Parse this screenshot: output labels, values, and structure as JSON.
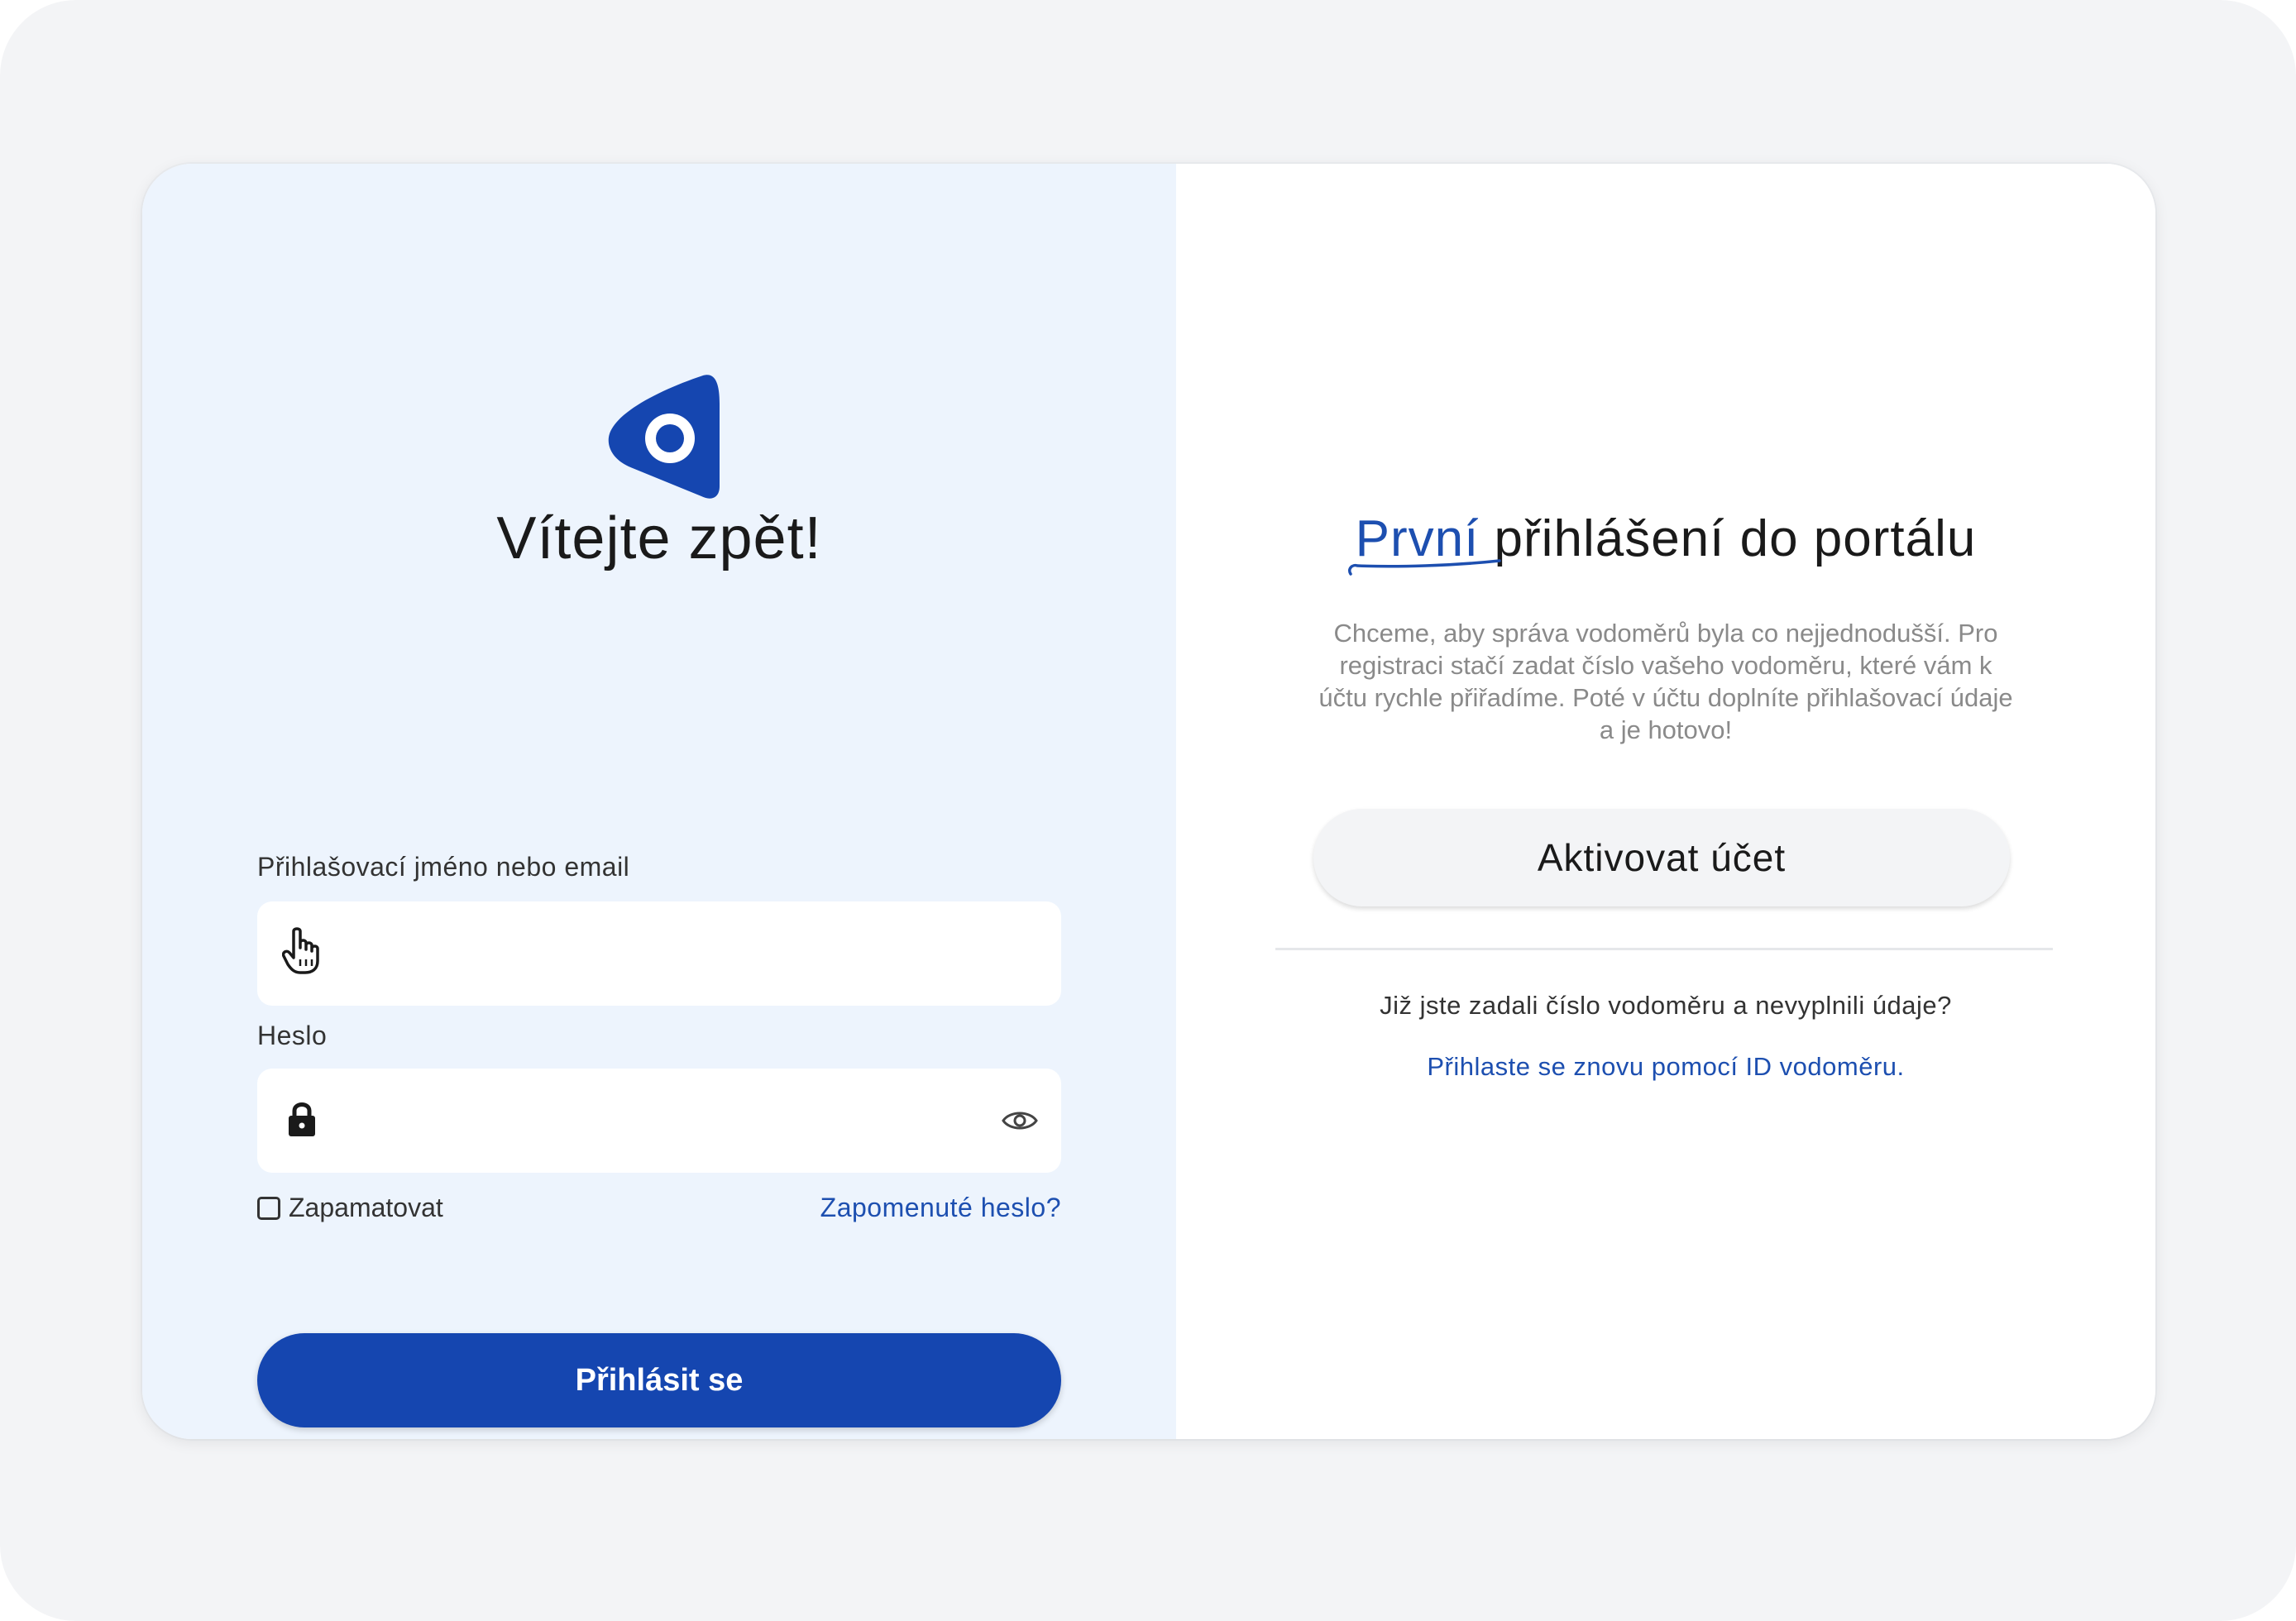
{
  "login": {
    "welcome_title": "Vítejte zpět!",
    "username_label": "Přihlašovací jméno nebo email",
    "username_value": "",
    "password_label": "Heslo",
    "password_value": "",
    "remember_label": "Zapamatovat",
    "remember_checked": false,
    "forgot_link": "Zapomenuté heslo?",
    "submit_label": "Přihlásit se"
  },
  "activation": {
    "heading_accent": "První",
    "heading_rest": " přihlášení do portálu",
    "description": "Chceme, aby správa vodoměrů byla co nejjednodušší. Pro registraci stačí zadat číslo vašeho vodoměru, které vám k účtu rychle přiřadíme. Poté v účtu doplníte přihlašovací údaje a je hotovo!",
    "activate_label": "Aktivovat účet",
    "question": "Již jste zadali číslo vodoměru a nevyplnili údaje?",
    "relogin_link": "Přihlaste se znovu pomocí ID vodoměru."
  },
  "icons": {
    "logo": "brand-logo",
    "username_field": "hand-pointer-icon",
    "password_field": "lock-icon",
    "password_toggle": "eye-icon"
  },
  "colors": {
    "brand_blue": "#1546b0",
    "link_blue": "#1d4fb0",
    "left_panel_bg": "#edf4fd",
    "page_bg": "#f3f4f6"
  }
}
